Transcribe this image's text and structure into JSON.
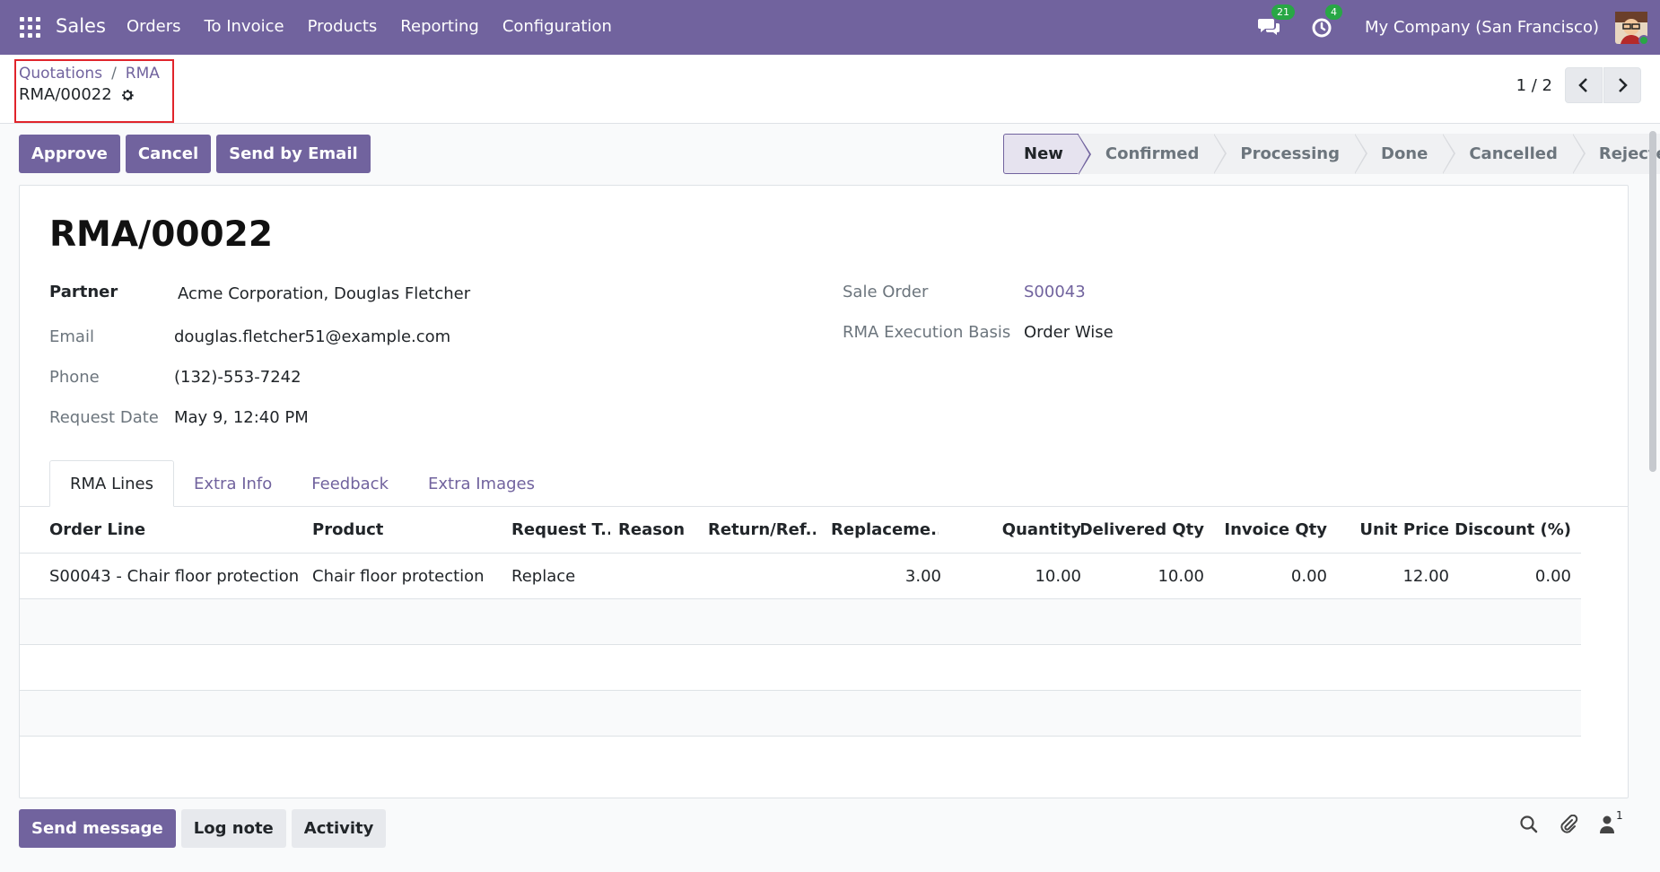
{
  "navbar": {
    "app_name": "Sales",
    "menu": [
      "Orders",
      "To Invoice",
      "Products",
      "Reporting",
      "Configuration"
    ],
    "messages_count": "21",
    "activities_count": "4",
    "company": "My Company (San Francisco)"
  },
  "breadcrumb": {
    "items": [
      "Quotations",
      "RMA"
    ],
    "separator": "/",
    "current": "RMA/00022"
  },
  "pager": {
    "value": "1 / 2"
  },
  "actions": {
    "approve": "Approve",
    "cancel": "Cancel",
    "send_email": "Send by Email"
  },
  "statusbar": {
    "stages": [
      "New",
      "Confirmed",
      "Processing",
      "Done",
      "Cancelled",
      "Rejected"
    ],
    "active": "New"
  },
  "form": {
    "title": "RMA/00022",
    "partner_label": "Partner",
    "partner": "Acme Corporation, Douglas Fletcher",
    "email_label": "Email",
    "email": "douglas.fletcher51@example.com",
    "phone_label": "Phone",
    "phone": "(132)-553-7242",
    "request_date_label": "Request Date",
    "request_date": "May 9, 12:40 PM",
    "sale_order_label": "Sale Order",
    "sale_order": "S00043",
    "execution_basis_label": "RMA Execution Basis",
    "execution_basis": "Order Wise"
  },
  "tabs": [
    "RMA Lines",
    "Extra Info",
    "Feedback",
    "Extra Images"
  ],
  "table": {
    "headers": [
      "Order Line",
      "Product",
      "Request T...",
      "Reason",
      "Return/Ref...",
      "Replaceme...",
      "Quantity",
      "Delivered Qty",
      "Invoice Qty",
      "Unit Price",
      "Discount (%)"
    ],
    "rows": [
      [
        "S00043 - Chair floor protection...",
        "Chair floor protection",
        "Replace",
        "",
        "",
        "3.00",
        "10.00",
        "10.00",
        "0.00",
        "12.00",
        "0.00"
      ]
    ]
  },
  "chatter": {
    "send_message": "Send message",
    "log_note": "Log note",
    "activity": "Activity",
    "followers_count": "1"
  },
  "colors": {
    "brand": "#71639e",
    "badge": "#28a745"
  }
}
